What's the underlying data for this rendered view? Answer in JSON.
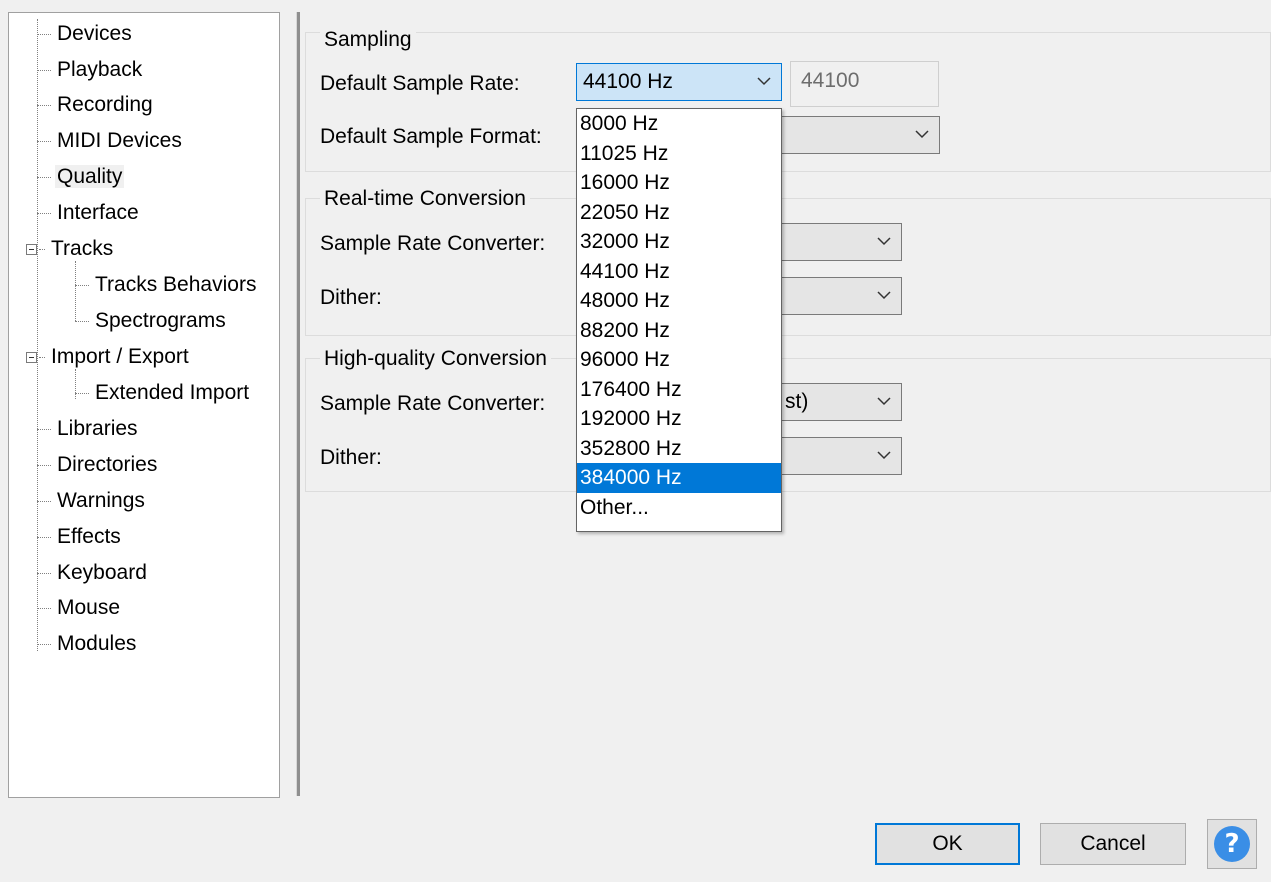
{
  "tree": {
    "items": [
      {
        "label": "Devices"
      },
      {
        "label": "Playback"
      },
      {
        "label": "Recording"
      },
      {
        "label": "MIDI Devices"
      },
      {
        "label": "Quality",
        "selected": true
      },
      {
        "label": "Interface"
      },
      {
        "label": "Tracks",
        "expanded": true
      },
      {
        "label": "Tracks Behaviors"
      },
      {
        "label": "Spectrograms"
      },
      {
        "label": "Import / Export",
        "expanded": true
      },
      {
        "label": "Extended Import"
      },
      {
        "label": "Libraries"
      },
      {
        "label": "Directories"
      },
      {
        "label": "Warnings"
      },
      {
        "label": "Effects"
      },
      {
        "label": "Keyboard"
      },
      {
        "label": "Mouse"
      },
      {
        "label": "Modules"
      }
    ]
  },
  "sampling": {
    "title": "Sampling",
    "rate_label": "Default Sample Rate:",
    "rate_value": "44100 Hz",
    "rate_text": "44100",
    "format_label": "Default Sample Format:"
  },
  "realtime": {
    "title": "Real-time Conversion",
    "converter_label": "Sample Rate Converter:",
    "dither_label": "Dither:"
  },
  "highquality": {
    "title": "High-quality Conversion",
    "converter_label": "Sample Rate Converter:",
    "converter_value_partial": "st)",
    "dither_label": "Dither:"
  },
  "dropdown": {
    "options": [
      "8000 Hz",
      "11025 Hz",
      "16000 Hz",
      "22050 Hz",
      "32000 Hz",
      "44100 Hz",
      "48000 Hz",
      "88200 Hz",
      "96000 Hz",
      "176400 Hz",
      "192000 Hz",
      "352800 Hz",
      "384000 Hz",
      "Other..."
    ],
    "highlighted": "384000 Hz"
  },
  "buttons": {
    "ok": "OK",
    "cancel": "Cancel",
    "help": "?"
  },
  "colors": {
    "accent": "#0078d7",
    "combo_active": "#cce4f7",
    "window_bg": "#f0f0f0",
    "help_icon": "#3a8ee6"
  }
}
